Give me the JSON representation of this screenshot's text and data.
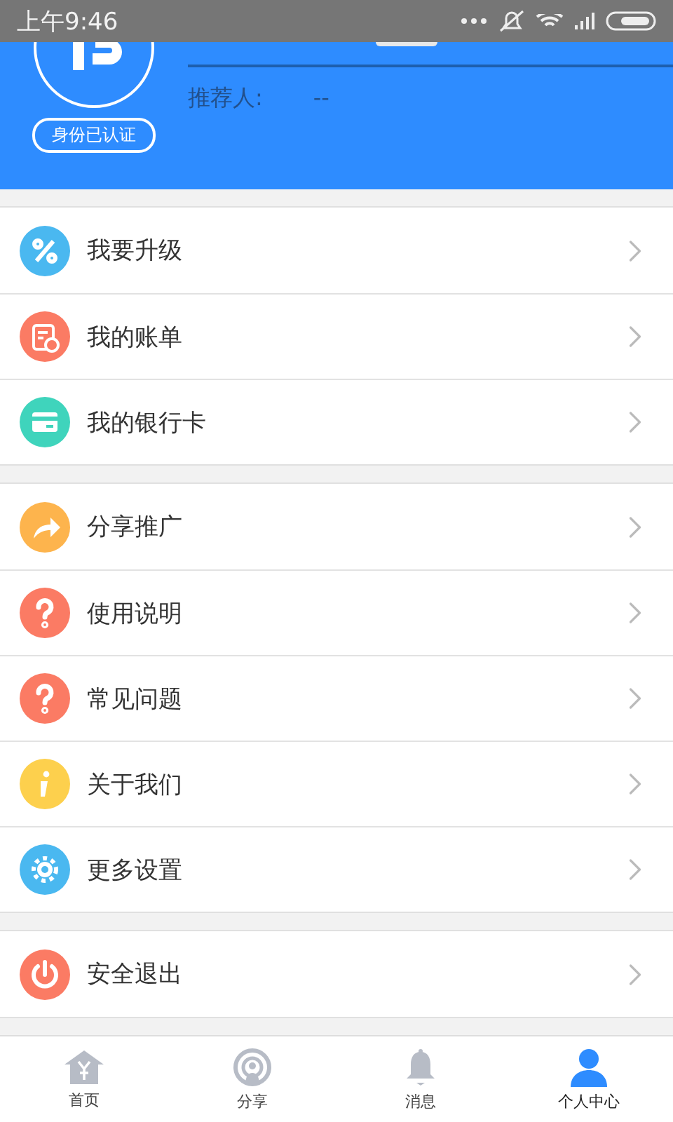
{
  "status_bar": {
    "time": "上午9:46"
  },
  "profile": {
    "badge": "身份已认证",
    "referrer_label": "推荐人:",
    "referrer_value": "--"
  },
  "menu_groups": [
    [
      {
        "label": "我要升级",
        "kind": "percent",
        "color": "#4ab8f0"
      },
      {
        "label": "我的账单",
        "kind": "bill",
        "color": "#fb7b64"
      },
      {
        "label": "我的银行卡",
        "kind": "card",
        "color": "#3fd4bc"
      }
    ],
    [
      {
        "label": "分享推广",
        "kind": "share",
        "color": "#fdb44d"
      },
      {
        "label": "使用说明",
        "kind": "help",
        "color": "#fb7b64"
      },
      {
        "label": "常见问题",
        "kind": "help",
        "color": "#fb7b64"
      },
      {
        "label": "关于我们",
        "kind": "info",
        "color": "#fdd04d"
      },
      {
        "label": "更多设置",
        "kind": "settings",
        "color": "#4ab8f0"
      }
    ],
    [
      {
        "label": "安全退出",
        "kind": "power",
        "color": "#fb7b64"
      }
    ]
  ],
  "tabs": [
    {
      "label": "首页",
      "kind": "home",
      "selected": false
    },
    {
      "label": "分享",
      "kind": "share",
      "selected": false
    },
    {
      "label": "消息",
      "kind": "bell",
      "selected": false
    },
    {
      "label": "个人中心",
      "kind": "person",
      "selected": true
    }
  ]
}
